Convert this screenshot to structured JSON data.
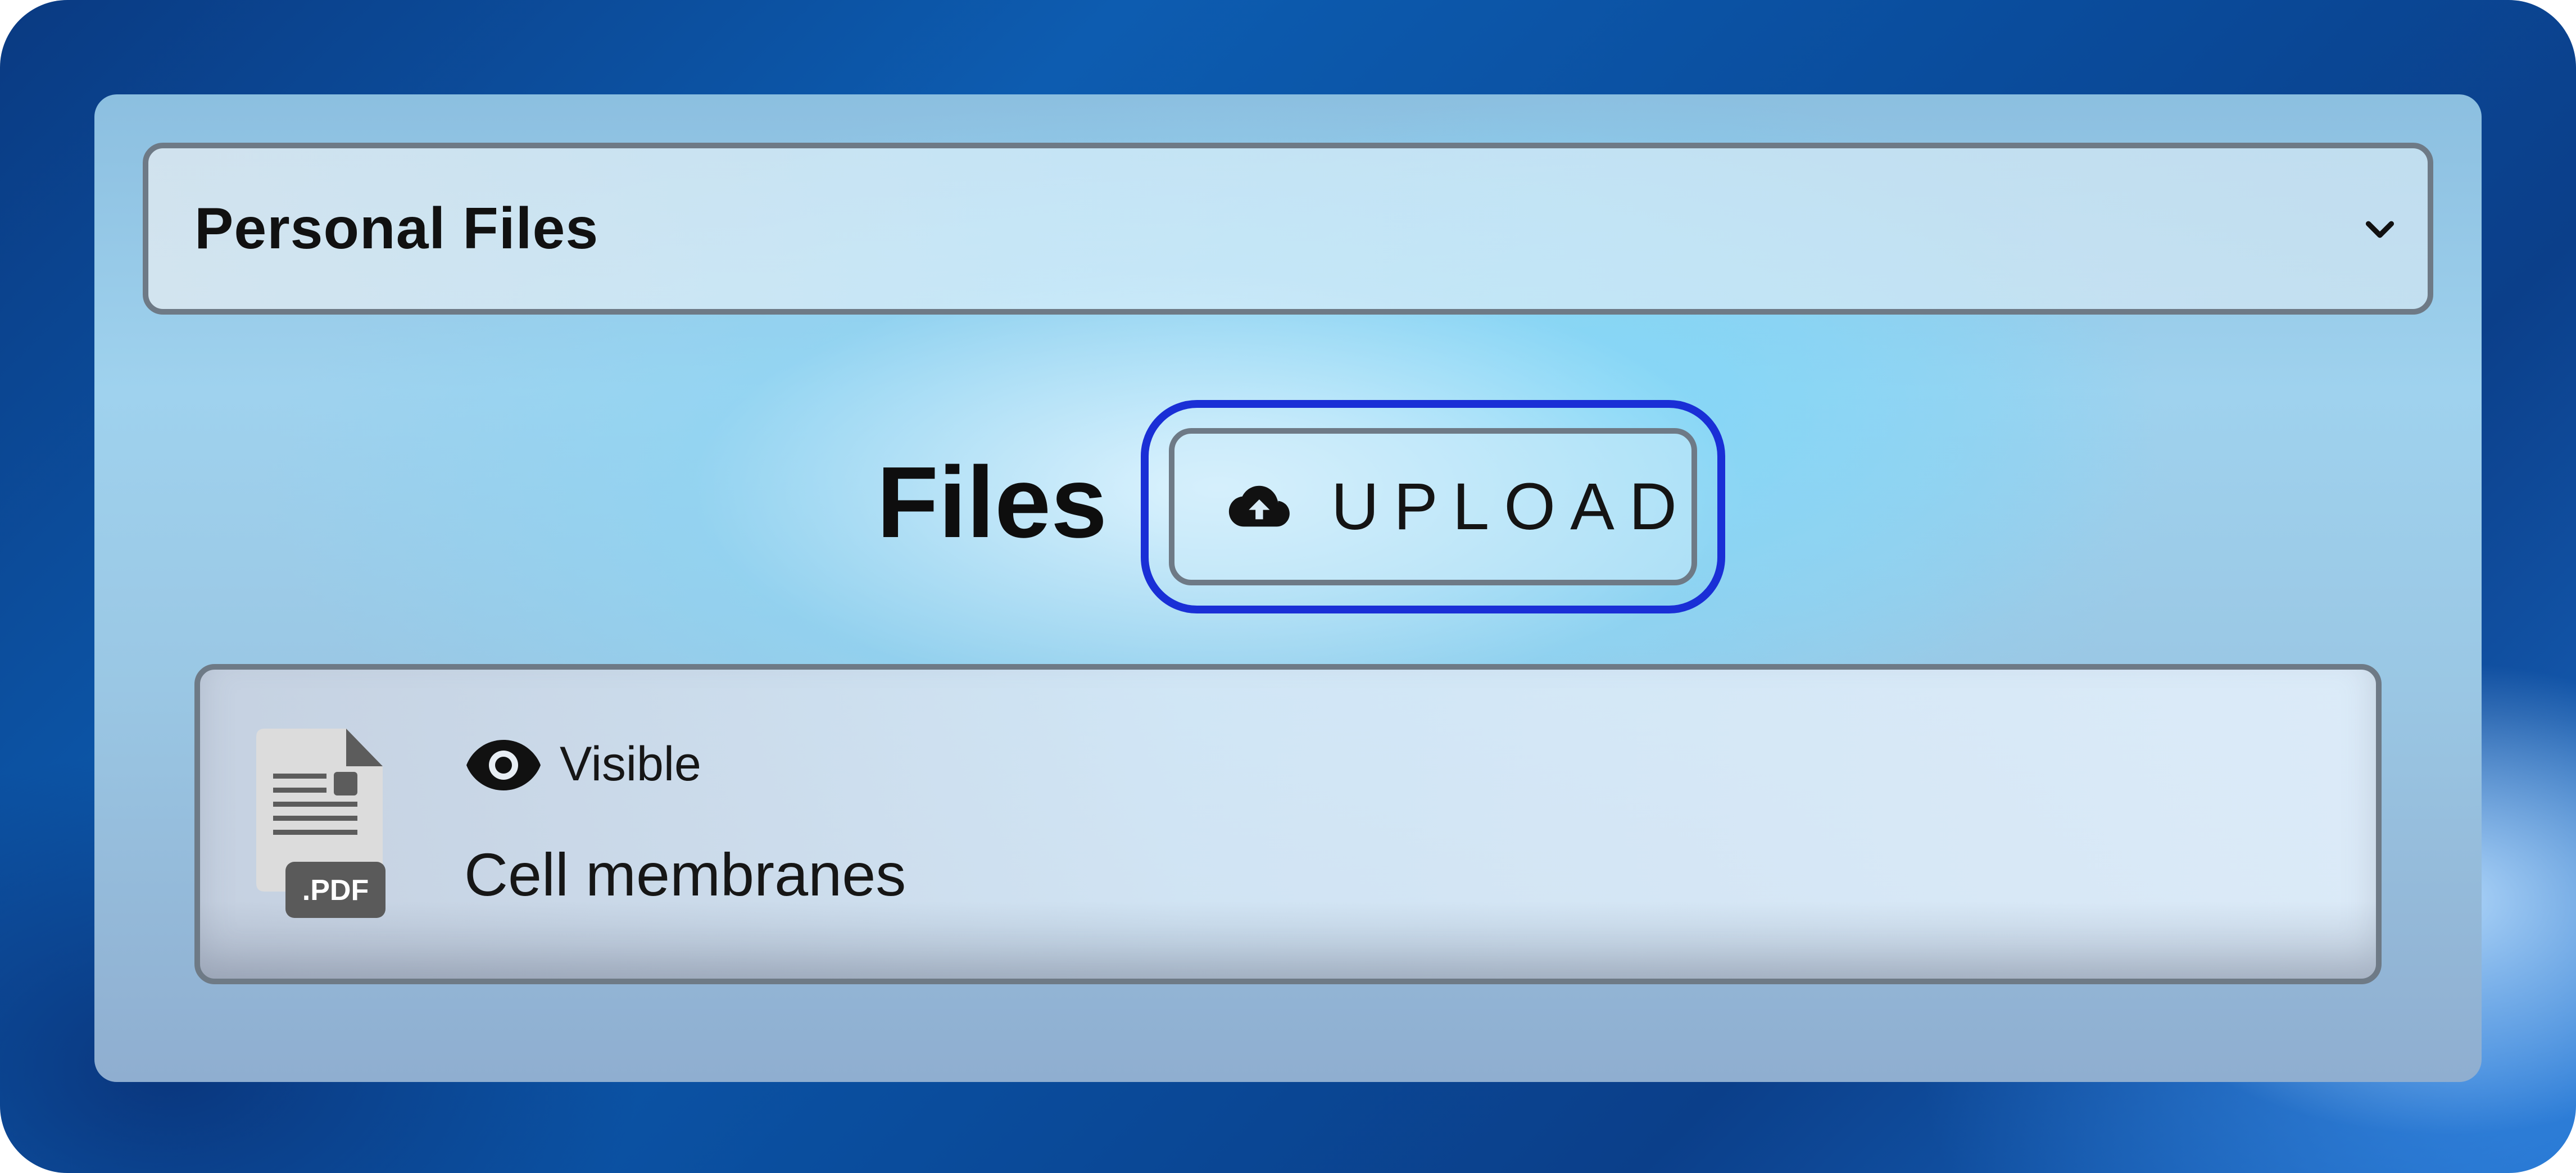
{
  "folder_select": {
    "selected": "Personal Files"
  },
  "files_section": {
    "title": "Files",
    "upload_label": "UPLOAD"
  },
  "files": [
    {
      "name": "Cell membranes",
      "visibility": "Visible",
      "file_type_badge": ".PDF"
    }
  ],
  "colors": {
    "focus_ring": "#1a2fd6",
    "border": "#6e7a86",
    "text": "#111111"
  }
}
